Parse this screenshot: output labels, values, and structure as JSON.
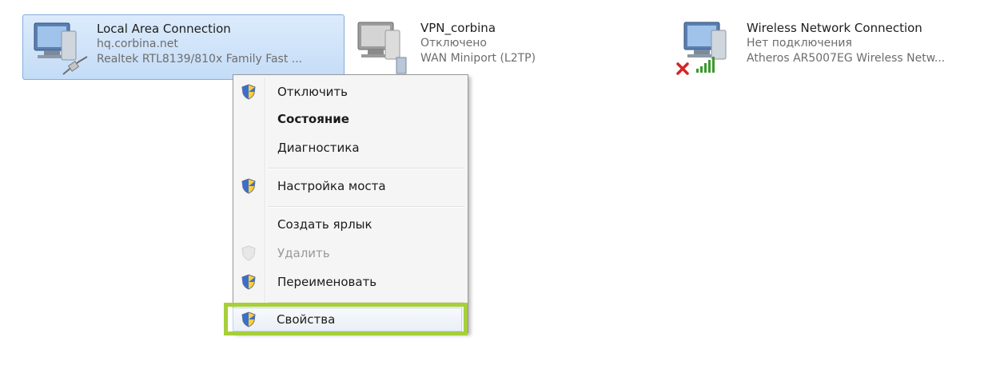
{
  "connections": [
    {
      "name": "Local Area Connection",
      "line1": "hq.corbina.net",
      "line2": "Realtek RTL8139/810x Family Fast ..."
    },
    {
      "name": "VPN_corbina",
      "line1": "Отключено",
      "line2": "WAN Miniport (L2TP)"
    },
    {
      "name": "Wireless Network Connection",
      "line1": "Нет подключения",
      "line2": "Atheros AR5007EG Wireless Netw..."
    }
  ],
  "context_menu": {
    "items": [
      {
        "label": "Отключить",
        "shield": true
      },
      {
        "label": "Состояние",
        "bold": true
      },
      {
        "label": "Диагностика"
      },
      {
        "label": "Настройка моста",
        "shield": true
      },
      {
        "label": "Создать ярлык"
      },
      {
        "label": "Удалить",
        "shield": true,
        "disabled": true
      },
      {
        "label": "Переименовать",
        "shield": true
      },
      {
        "label": "Свойства",
        "shield": true,
        "highlighted": true
      }
    ]
  },
  "colors": {
    "highlight_border": "#a6cf3a",
    "selection": "#c4dcf7"
  },
  "icons": {
    "network": "network-adapter-icon",
    "cable": "ethernet-cable-icon",
    "disconnected": "red-x-icon",
    "signal": "wireless-signal-icon",
    "shield": "uac-shield-icon"
  }
}
